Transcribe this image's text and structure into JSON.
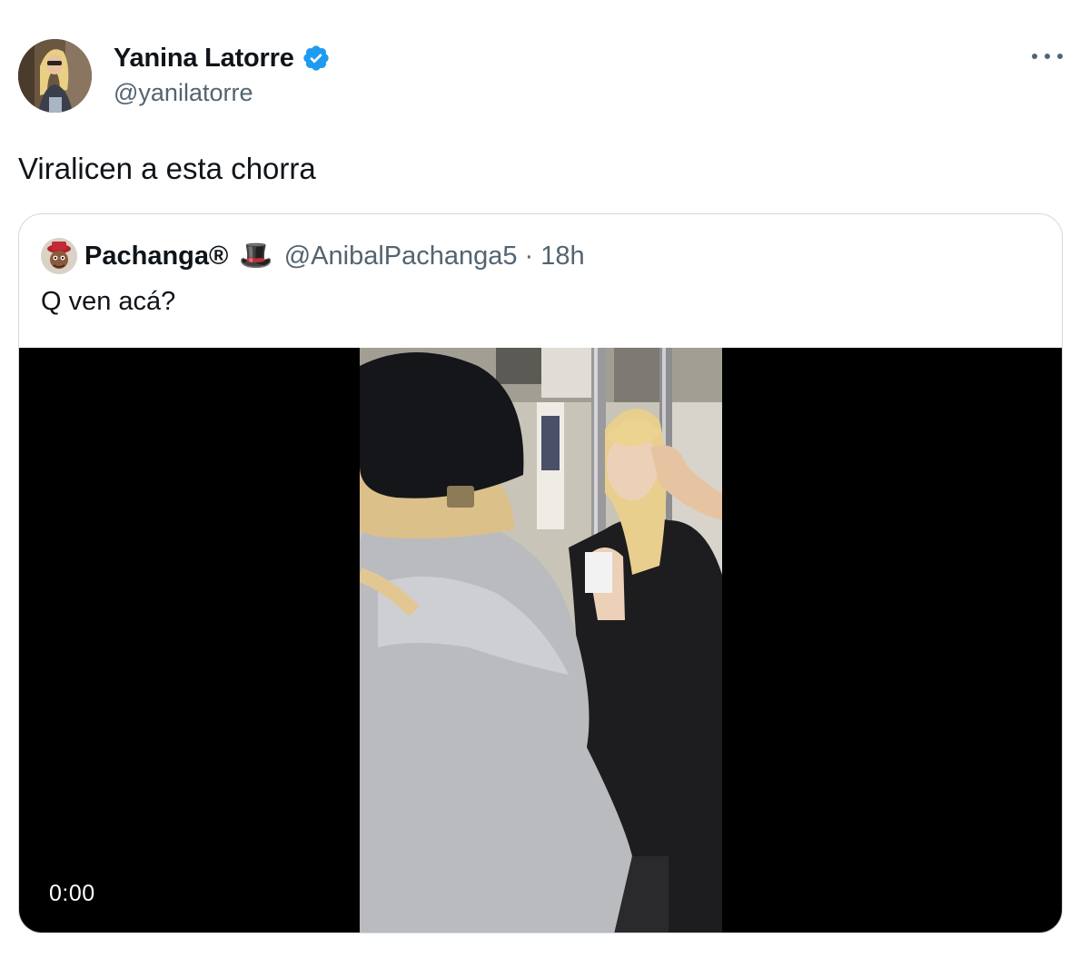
{
  "tweet": {
    "author_name": "Yanina Latorre",
    "author_handle": "@yanilatorre",
    "text": "Viralicen a esta chorra",
    "avatar_icon": "profile-photo",
    "verified_icon": "verified-badge-icon",
    "more_icon": "more-options-icon"
  },
  "quote": {
    "author_name": "Pachanga®",
    "author_emoji": "🎩",
    "author_handle": "@AnibalPachanga5",
    "separator": "·",
    "time": "18h",
    "text": "Q ven acá?",
    "video": {
      "timecode": "0:00"
    }
  },
  "colors": {
    "verified": "#1d9bf0",
    "secondary_text": "#536471",
    "border": "#cfd9de",
    "media_background": "#000000"
  }
}
